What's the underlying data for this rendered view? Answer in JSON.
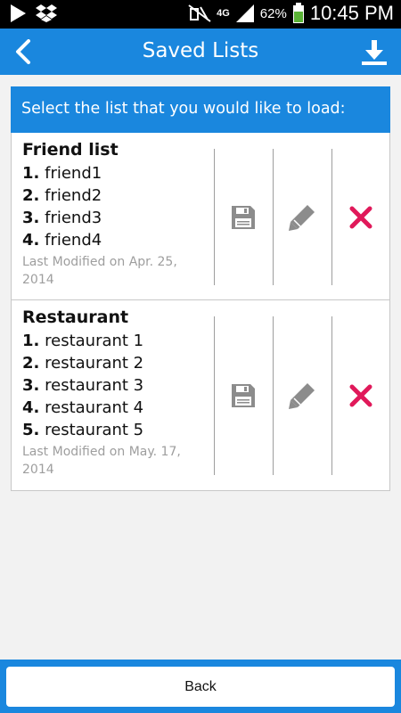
{
  "status_bar": {
    "network": "4G",
    "battery": "62%",
    "time": "10:45 PM"
  },
  "app_bar": {
    "title": "Saved Lists"
  },
  "panel": {
    "header": "Select the list that you would like to load:"
  },
  "lists": [
    {
      "name": "Friend list",
      "items": [
        {
          "num": "1.",
          "text": "friend1"
        },
        {
          "num": "2.",
          "text": "friend2"
        },
        {
          "num": "3.",
          "text": "friend3"
        },
        {
          "num": "4.",
          "text": "friend4"
        }
      ],
      "modified_line1": "Last Modified on Apr. 25,",
      "modified_line2": "2014"
    },
    {
      "name": "Restaurant",
      "items": [
        {
          "num": "1.",
          "text": "restaurant 1"
        },
        {
          "num": "2.",
          "text": "restaurant 2"
        },
        {
          "num": "3.",
          "text": "restaurant 3"
        },
        {
          "num": "4.",
          "text": "restaurant 4"
        },
        {
          "num": "5.",
          "text": "restaurant 5"
        }
      ],
      "modified_line1": "Last Modified on May. 17,",
      "modified_line2": "2014"
    }
  ],
  "icons": {
    "save": "floppy-disk-icon",
    "edit": "pencil-icon",
    "delete": "close-icon",
    "back": "chevron-left-icon",
    "download": "download-icon"
  },
  "colors": {
    "primary": "#1a87de",
    "delete": "#e0195a",
    "icon_gray": "#8c8c8c"
  },
  "bottom": {
    "back_label": "Back"
  }
}
